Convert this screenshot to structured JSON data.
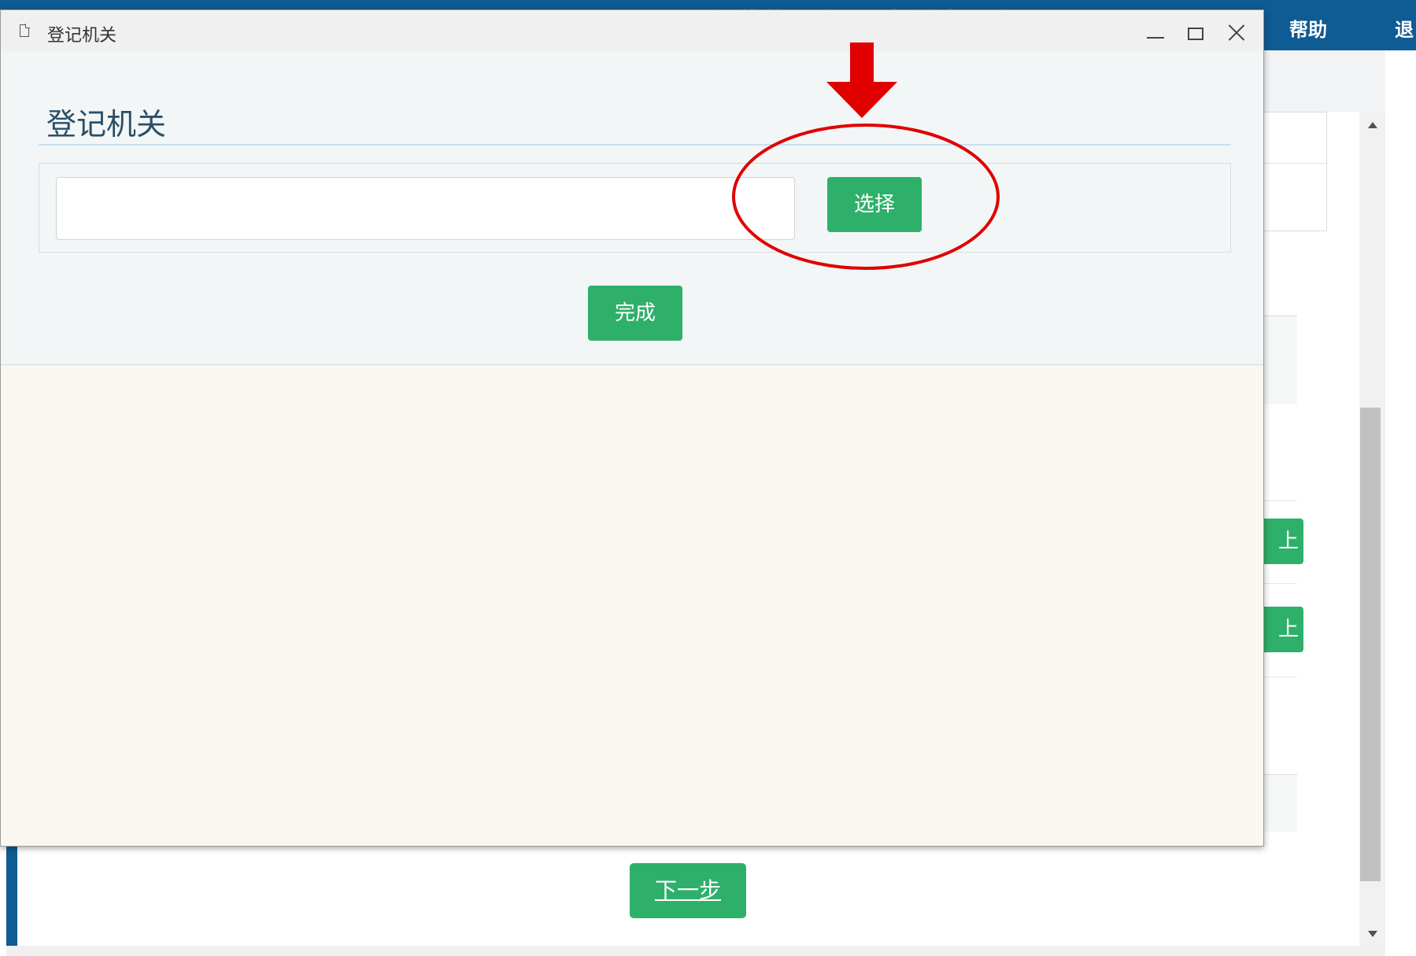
{
  "app": {
    "header_faded_text": "经营范围登记及相关事项登记",
    "help_label": "帮助",
    "exit_label": "退"
  },
  "background": {
    "upload_label_1": "上传",
    "upload_label_2": "上传",
    "next_button_label": "下一步"
  },
  "dialog": {
    "window_title": "登记机关",
    "section_heading": "登记机关",
    "authority_input_value": "",
    "select_button_label": "选择",
    "done_button_label": "完成"
  },
  "colors": {
    "header_blue": "#0f5b93",
    "button_green": "#2fb06a",
    "annotation_red": "#e00000"
  },
  "icons": [
    "page-icon",
    "minimize-icon",
    "maximize-icon",
    "close-icon",
    "scroll-up-icon",
    "scroll-down-icon",
    "down-arrow-icon"
  ]
}
